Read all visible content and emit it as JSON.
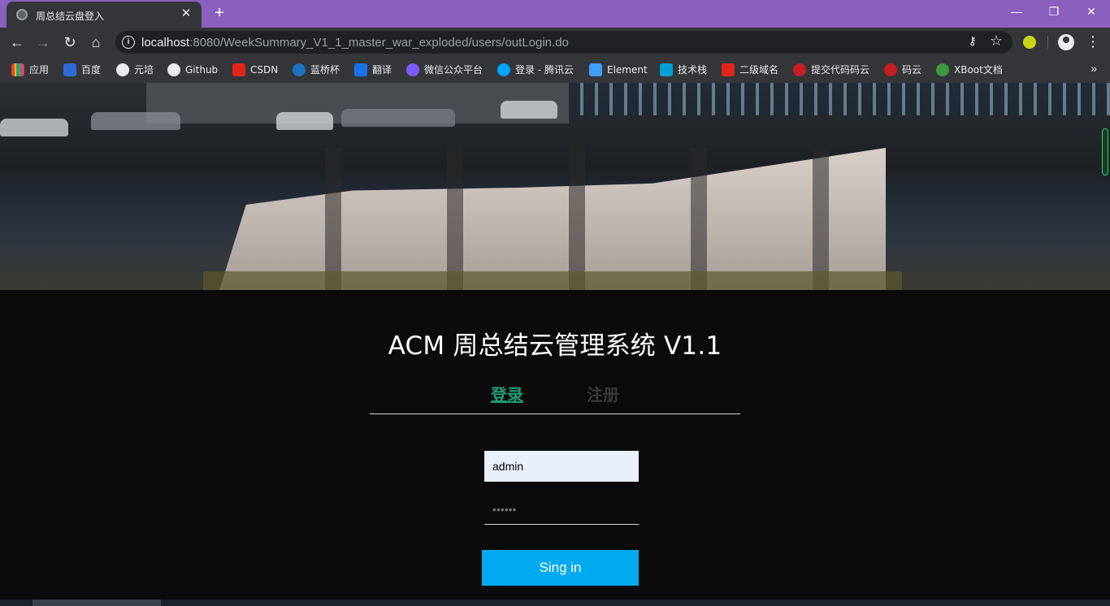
{
  "browser": {
    "tab_title": "周总结云盘登入",
    "tab_close": "✕",
    "new_tab": "+",
    "window_controls": {
      "minimize": "—",
      "restore": "❐",
      "close": "✕"
    },
    "nav": {
      "back": "←",
      "forward": "→",
      "reload": "↻",
      "home": "⌂"
    },
    "url_host": "localhost",
    "url_path": ":8080/WeekSummary_V1_1_master_war_exploded/users/outLogin.do",
    "menu": "⋮",
    "bookmarks_more": "»"
  },
  "bookmarks": [
    {
      "label": "应用",
      "color": "#e8453c"
    },
    {
      "label": "百度",
      "color": "#2f6bd8"
    },
    {
      "label": "元培",
      "color": "#e8eaed"
    },
    {
      "label": "Github",
      "color": "#e8eaed"
    },
    {
      "label": "CSDN",
      "color": "#e1251b"
    },
    {
      "label": "蓝桥杯",
      "color": "#1e73be"
    },
    {
      "label": "翻译",
      "color": "#1a73e8"
    },
    {
      "label": "微信公众平台",
      "color": "#7c5cff"
    },
    {
      "label": "登录 - 腾讯云",
      "color": "#00a3ff"
    },
    {
      "label": "Element",
      "color": "#409eff"
    },
    {
      "label": "技术栈",
      "color": "#00a1d6"
    },
    {
      "label": "二级域名",
      "color": "#e1251b"
    },
    {
      "label": "提交代码码云",
      "color": "#c71d23"
    },
    {
      "label": "码云",
      "color": "#c71d23"
    },
    {
      "label": "XBoot文档",
      "color": "#3c9a3c"
    }
  ],
  "page": {
    "app_title": "ACM 周总结云管理系统 V1.1",
    "tabs": {
      "login": "登录",
      "register": "注册"
    },
    "login_form": {
      "username_value": "admin",
      "password_placeholder": "••••••",
      "submit_label": "Sing in"
    },
    "colors": {
      "accent_green": "#1f9a77",
      "button_blue": "#00aaf0",
      "page_bg": "#0b0b0c"
    }
  }
}
